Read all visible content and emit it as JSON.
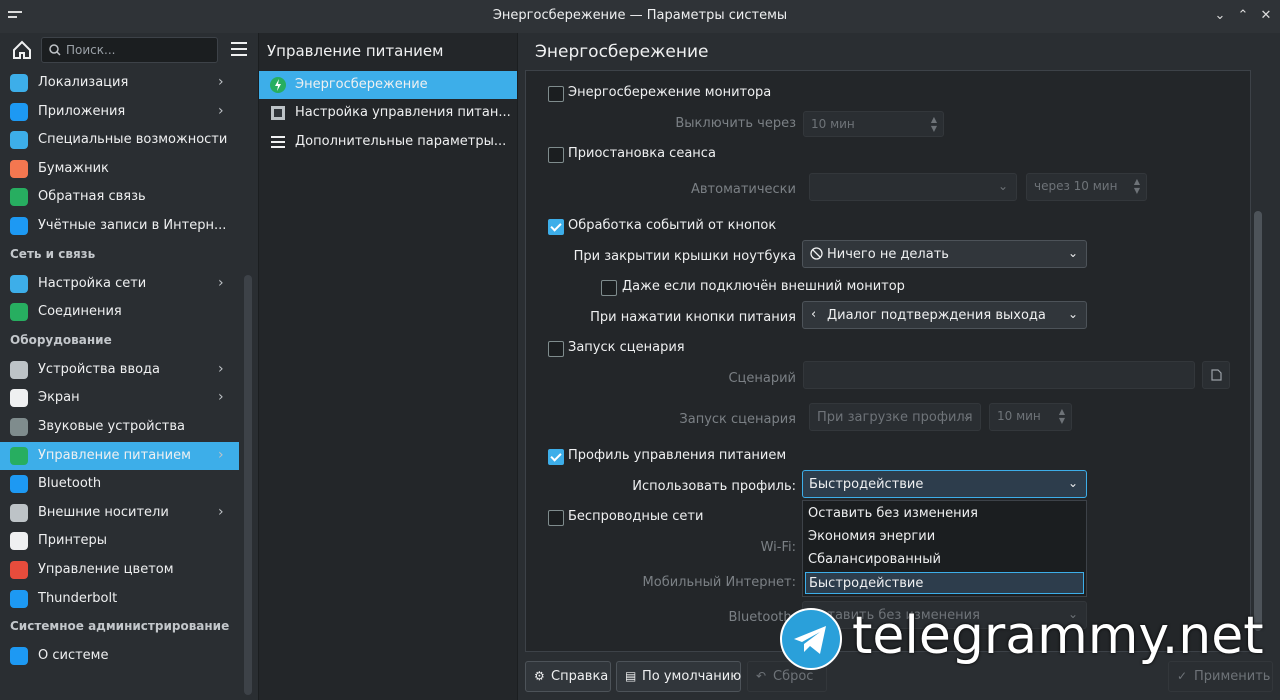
{
  "window": {
    "title": "Энергосбережение — Параметры системы"
  },
  "sidebar": {
    "search_placeholder": "Поиск...",
    "items_top": [
      {
        "label": "Локализация",
        "icon": "localization-icon",
        "color": "#3daee9",
        "chevron": true
      },
      {
        "label": "Приложения",
        "icon": "apps-icon",
        "color": "#1d99f3",
        "chevron": true
      },
      {
        "label": "Специальные возможности",
        "icon": "accessibility-icon",
        "color": "#3daee9",
        "chevron": false
      },
      {
        "label": "Бумажник",
        "icon": "wallet-icon",
        "color": "#f47750",
        "chevron": false
      },
      {
        "label": "Обратная связь",
        "icon": "feedback-icon",
        "color": "#27ae60",
        "chevron": false
      },
      {
        "label": "Учётные записи в Интерн...",
        "icon": "online-accounts-icon",
        "color": "#1d99f3",
        "chevron": false
      }
    ],
    "section_network": "Сеть и связь",
    "items_network": [
      {
        "label": "Настройка сети",
        "icon": "network-icon",
        "color": "#3daee9",
        "chevron": true
      },
      {
        "label": "Соединения",
        "icon": "connections-icon",
        "color": "#27ae60",
        "chevron": false
      }
    ],
    "section_hardware": "Оборудование",
    "items_hardware": [
      {
        "label": "Устройства ввода",
        "icon": "mouse-icon",
        "color": "#bdc3c7",
        "chevron": true
      },
      {
        "label": "Экран",
        "icon": "display-icon",
        "color": "#eff0f1",
        "chevron": true
      },
      {
        "label": "Звуковые устройства",
        "icon": "speaker-icon",
        "color": "#7f8c8d",
        "chevron": false
      },
      {
        "label": "Управление питанием",
        "icon": "power-icon",
        "color": "#27ae60",
        "chevron": true
      },
      {
        "label": "Bluetooth",
        "icon": "bluetooth-icon",
        "color": "#1d99f3",
        "chevron": false
      },
      {
        "label": "Внешние носители",
        "icon": "removable-media-icon",
        "color": "#bdc3c7",
        "chevron": true
      },
      {
        "label": "Принтеры",
        "icon": "printer-icon",
        "color": "#eff0f1",
        "chevron": false
      },
      {
        "label": "Управление цветом",
        "icon": "color-management-icon",
        "color": "#e74c3c",
        "chevron": false
      },
      {
        "label": "Thunderbolt",
        "icon": "thunderbolt-icon",
        "color": "#1d99f3",
        "chevron": false
      }
    ],
    "section_admin": "Системное администрирование",
    "items_admin": [
      {
        "label": "О системе",
        "icon": "about-icon",
        "color": "#1d99f3",
        "chevron": false
      }
    ]
  },
  "middle": {
    "header": "Управление питанием",
    "items": [
      {
        "label": "Энергосбережение",
        "icon": "energy-saving-icon"
      },
      {
        "label": "Настройка управления питан...",
        "icon": "activity-settings-icon"
      },
      {
        "label": "Дополнительные параметры...",
        "icon": "advanced-settings-icon"
      }
    ]
  },
  "main": {
    "header": "Энергосбережение",
    "dpms": {
      "label": "Энергосбережение монитора",
      "checked": false,
      "off_label": "Выключить через",
      "off_value": "10 мин"
    },
    "suspend": {
      "label": "Приостановка сеанса",
      "checked": false,
      "auto_label": "Автоматически",
      "auto_value": "",
      "after_value": "через 10 мин"
    },
    "buttons": {
      "label": "Обработка событий от кнопок",
      "checked": true,
      "lid_label": "При закрытии крышки ноутбука",
      "lid_value": "Ничего не делать",
      "external_monitor_label": "Даже если подключён внешний монитор",
      "external_monitor_checked": false,
      "power_label": "При нажатии кнопки питания",
      "power_value": "Диалог подтверждения выхода"
    },
    "script": {
      "label": "Запуск сценария",
      "checked": false,
      "script_label": "Сценарий",
      "script_value": "",
      "run_label": "Запуск сценария",
      "run_value": "При загрузке профиля",
      "time_value": "10 мин"
    },
    "profile": {
      "label": "Профиль управления питанием",
      "checked": true,
      "use_label": "Использовать профиль:",
      "use_value": "Быстродействие",
      "options": [
        "Оставить без изменения",
        "Экономия энергии",
        "Сбалансированный",
        "Быстродействие"
      ],
      "selected_index": 3
    },
    "wireless": {
      "label": "Беспроводные сети",
      "checked": false,
      "wifi_label": "Wi-Fi:",
      "mobile_label": "Мобильный Интернет:",
      "bluetooth_label": "Bluetooth:",
      "bluetooth_value": "Оставить без изменения"
    }
  },
  "footer": {
    "help": "Справка",
    "defaults": "По умолчанию",
    "reset": "Сброс",
    "apply": "Применить"
  },
  "watermark": {
    "text": "telegrammy.net"
  },
  "colors": {
    "accent": "#3daee9",
    "bg": "#232629",
    "panel": "#2a2e32"
  }
}
